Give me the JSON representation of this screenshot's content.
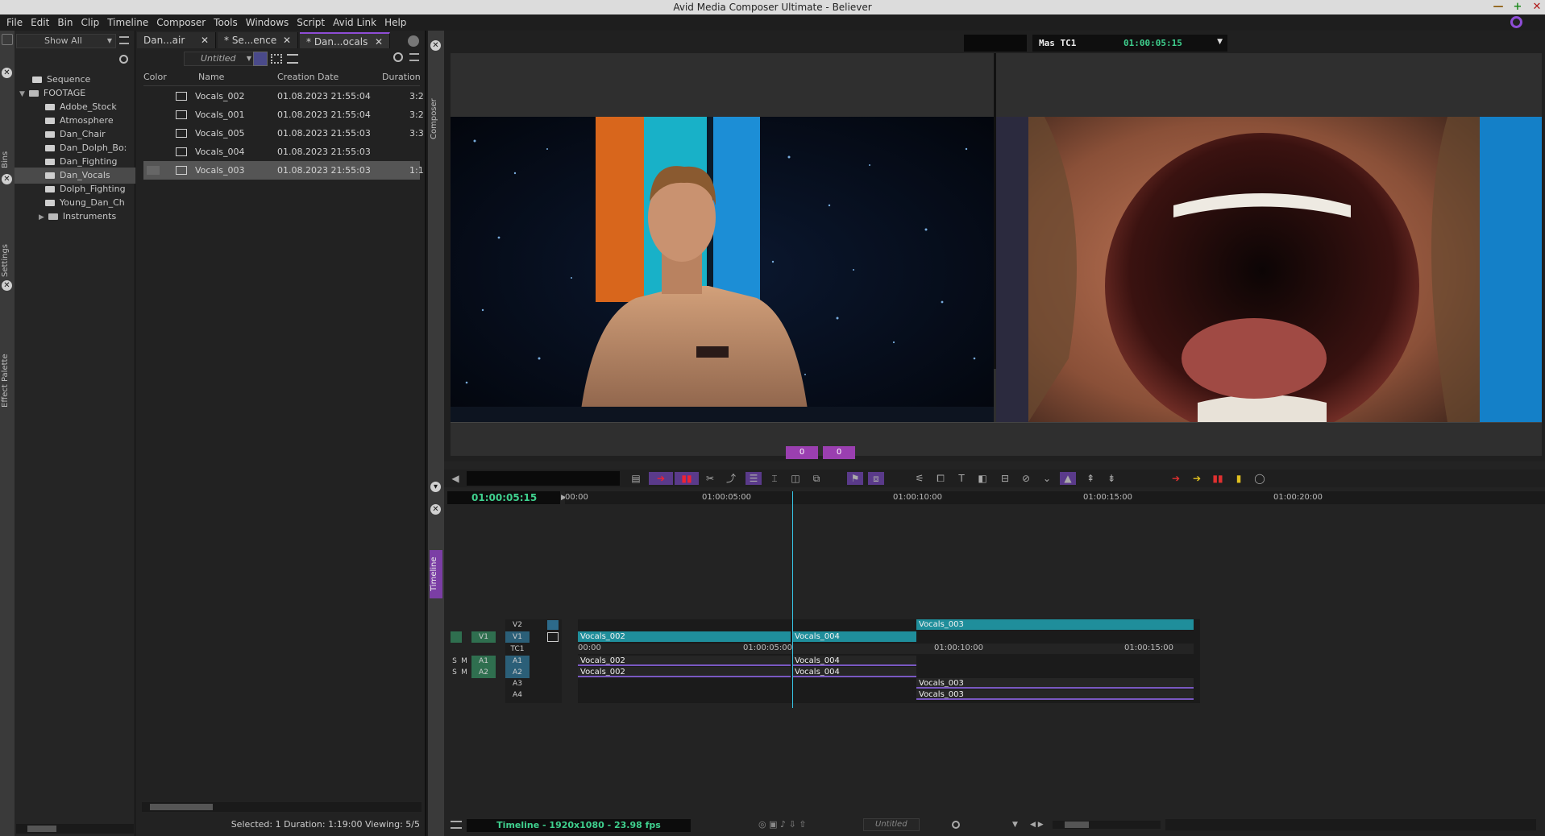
{
  "window": {
    "title": "Avid Media Composer Ultimate - Believer",
    "min": "—",
    "max": "+",
    "close": "✕"
  },
  "menu": [
    "File",
    "Edit",
    "Bin",
    "Clip",
    "Timeline",
    "Composer",
    "Tools",
    "Windows",
    "Script",
    "Avid Link",
    "Help"
  ],
  "left_tabs": [
    "Bins",
    "Settings",
    "Effect Palette"
  ],
  "folder_panel": {
    "filter": "Show All",
    "items": [
      {
        "label": "Sequence",
        "indent": 1,
        "type": "bin"
      },
      {
        "label": "FOOTAGE",
        "indent": 0,
        "type": "folder",
        "expanded": true
      },
      {
        "label": "Adobe_Stock",
        "indent": 2,
        "type": "bin"
      },
      {
        "label": "Atmosphere",
        "indent": 2,
        "type": "bin"
      },
      {
        "label": "Dan_Chair",
        "indent": 2,
        "type": "bin"
      },
      {
        "label": "Dan_Dolph_Bo:",
        "indent": 2,
        "type": "bin"
      },
      {
        "label": "Dan_Fighting",
        "indent": 2,
        "type": "bin"
      },
      {
        "label": "Dan_Vocals",
        "indent": 2,
        "type": "bin",
        "selected": true
      },
      {
        "label": "Dolph_Fighting",
        "indent": 2,
        "type": "bin"
      },
      {
        "label": "Young_Dan_Ch",
        "indent": 2,
        "type": "bin"
      },
      {
        "label": "Instruments",
        "indent": 1,
        "type": "folder",
        "expanded": false
      }
    ]
  },
  "bin": {
    "tabs": [
      {
        "label": "Dan...air",
        "active": false
      },
      {
        "label": "* Se...ence",
        "active": false
      },
      {
        "label": "* Dan...ocals",
        "active": true
      }
    ],
    "view_name": "Untitled",
    "columns": [
      "Color",
      "Name",
      "Creation Date",
      "Duration"
    ],
    "rows": [
      {
        "name": "Vocals_002",
        "date": "01.08.2023 21:55:04",
        "duration": "3:2",
        "selected": false
      },
      {
        "name": "Vocals_001",
        "date": "01.08.2023 21:55:04",
        "duration": "3:2",
        "selected": false
      },
      {
        "name": "Vocals_005",
        "date": "01.08.2023 21:55:03",
        "duration": "3:3",
        "selected": false
      },
      {
        "name": "Vocals_004",
        "date": "01.08.2023 21:55:03",
        "duration": "",
        "selected": false
      },
      {
        "name": "Vocals_003",
        "date": "01.08.2023 21:55:03",
        "duration": "1:1",
        "selected": true
      }
    ],
    "status": "Selected: 1  Duration: 1:19:00  Viewing: 5/5"
  },
  "composer": {
    "side_label": "Composer",
    "tc_label": "Mas TC1",
    "timecode": "01:00:05:15",
    "source_badge": "0",
    "record_badge": "0"
  },
  "timeline": {
    "side_label": "Timeline",
    "timecode": "01:00:05:15",
    "ruler_ticks": [
      "00:00",
      "01:00:05:00",
      "01:00:10:00",
      "01:00:15:00",
      "01:00:20:00"
    ],
    "tc1_ticks": [
      "00:00",
      "01:00:05:00",
      "01:00:10:00",
      "01:00:15:00"
    ],
    "tracks": {
      "v2": "V2",
      "v1": "V1",
      "tc1": "TC1",
      "a1": "A1",
      "a2": "A2",
      "a3": "A3",
      "a4": "A4",
      "src_v1": "V1",
      "src_a1": "A1",
      "src_a2": "A2",
      "s": "S",
      "m": "M"
    },
    "clips": {
      "v2_c1": "Vocals_003",
      "v1_c1": "Vocals_002",
      "v1_c2": "Vocals_004",
      "a1_c1": "Vocals_002",
      "a1_c2": "Vocals_004",
      "a2_c1": "Vocals_002",
      "a2_c2": "Vocals_004",
      "a3_c1": "Vocals_003",
      "a4_c1": "Vocals_003"
    },
    "status": "Timeline - 1920x1080 - 23.98 fps",
    "view_name": "Untitled"
  },
  "colors": {
    "accent": "#8e4dd6",
    "playhead": "#37c7e8",
    "video_clip": "#1f8e9b",
    "timecode_green": "#3fd08e"
  }
}
